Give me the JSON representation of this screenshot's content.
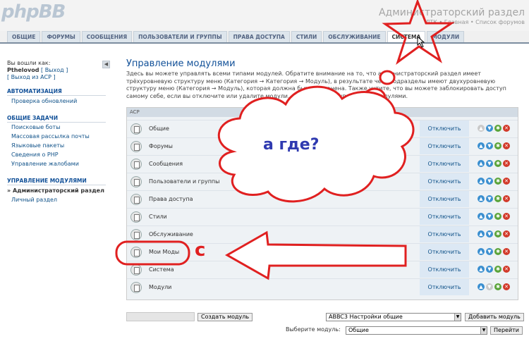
{
  "header": {
    "logo": "phpBB",
    "title": "Администраторский раздел",
    "links": "ЛТК • Главная • Список форумов"
  },
  "tabs": [
    "Общие",
    "Форумы",
    "Сообщения",
    "Пользователи и группы",
    "Права доступа",
    "Стили",
    "Обслуживание",
    "Система",
    "Модули"
  ],
  "sidebar": {
    "logged_in_as": "Вы вошли как:",
    "username": "Pthelovod",
    "logout": "[ Выход ]",
    "acp_logout": "[ Выход из ACP ]",
    "sections": [
      {
        "title": "Автоматизация",
        "items": [
          "Проверка обновлений"
        ]
      },
      {
        "title": "Общие задачи",
        "items": [
          "Поисковые боты",
          "Массовая рассылка почты",
          "Языковые пакеты",
          "Сведения о PHP",
          "Управление жалобами"
        ]
      },
      {
        "title": "Управление модулями",
        "items": [
          "Администраторский раздел",
          "Личный раздел"
        ]
      }
    ]
  },
  "main": {
    "title": "Управление модулями",
    "description": "Здесь вы можете управлять всеми типами модулей. Обратите внимание на то, что администраторский раздел имеет трёхуровневую структуру меню (Категория → Категория → Модуль), в результате чего подразделы имеют двухуровневую структуру меню (Категория → Модуль), которая должна быть сохранена. Также учтите, что вы можете заблокировать доступ самому себе, если вы отключите или удалите модули, отвечающие за управление модулями.",
    "table_header": "ACP",
    "rows": [
      {
        "name": "Общие",
        "action": "Отключить"
      },
      {
        "name": "Форумы",
        "action": "Отключить"
      },
      {
        "name": "Сообщения",
        "action": "Отключить"
      },
      {
        "name": "Пользователи и группы",
        "action": "Отключить"
      },
      {
        "name": "Права доступа",
        "action": "Отключить"
      },
      {
        "name": "Стили",
        "action": "Отключить"
      },
      {
        "name": "Обслуживание",
        "action": "Отключить"
      },
      {
        "name": "Мои Моды",
        "action": "Отключить"
      },
      {
        "name": "Система",
        "action": "Отключить"
      },
      {
        "name": "Модули",
        "action": "Отключить"
      }
    ],
    "create_button": "Создать модуль",
    "module_select": "ABBC3 Настройки общие",
    "add_button": "Добавить модуль",
    "choose_label": "Выберите модуль:",
    "choose_select": "Общие",
    "go_button": "Перейти"
  },
  "annotations": {
    "cloud_text": "а где?",
    "c_text": "с",
    "colors": {
      "red": "#e02020",
      "blue": "#2f3ab0"
    }
  }
}
